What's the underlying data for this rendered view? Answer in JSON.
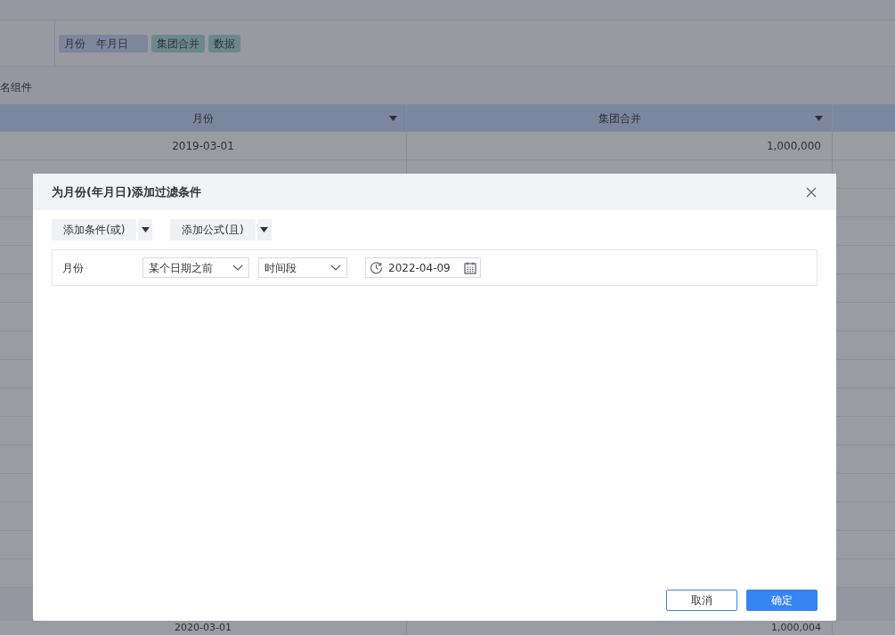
{
  "background": {
    "chips": [
      {
        "label": "月份",
        "sub": "年月日",
        "kind": "dimension"
      },
      {
        "label": "集团合并",
        "kind": "measure"
      },
      {
        "label": "数据",
        "kind": "measure"
      }
    ],
    "component_name": "名组件",
    "table": {
      "columns": [
        "月份",
        "集团合并"
      ],
      "rows": [
        [
          "2019-03-01",
          "1,000,000"
        ]
      ],
      "last_row": [
        "2020-03-01",
        "1,000,004"
      ]
    }
  },
  "dialog": {
    "title": "为月份(年月日)添加过滤条件",
    "add_buttons": [
      "添加条件(或)",
      "添加公式(且)"
    ],
    "condition": {
      "field": "月份",
      "operator": "某个日期之前",
      "mode": "时间段",
      "date": "2022-04-09"
    },
    "buttons": [
      {
        "label": "取消",
        "kind": "secondary"
      },
      {
        "label": "确定",
        "kind": "primary"
      }
    ]
  }
}
